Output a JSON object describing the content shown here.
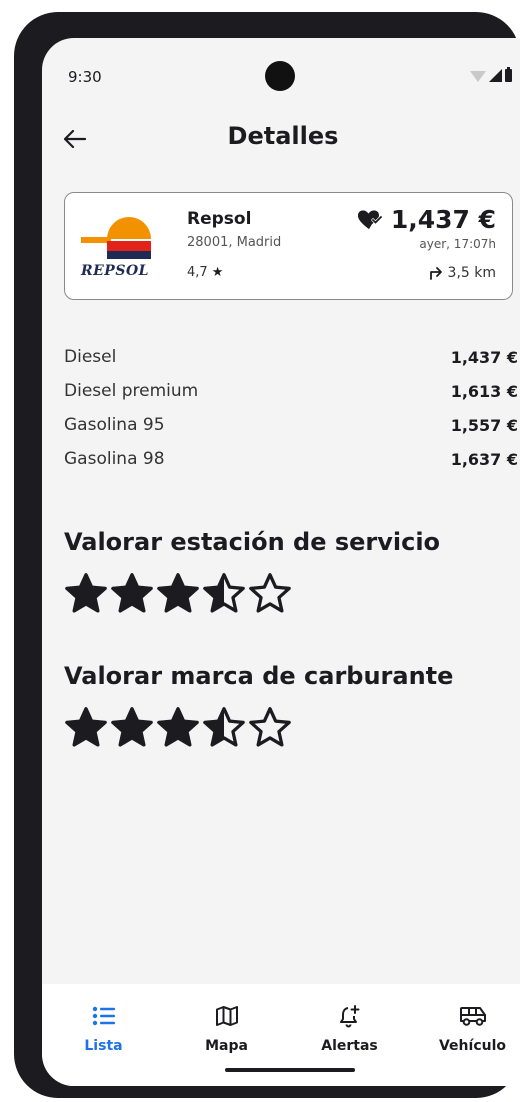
{
  "status_bar": {
    "time": "9:30"
  },
  "app_bar": {
    "title": "Detalles",
    "back_icon": "arrow-left-icon"
  },
  "station": {
    "brand_logo_text": "REPSOL",
    "name": "Repsol",
    "address": "28001, Madrid",
    "rating": "4,7",
    "price": "1,437 €",
    "updated": "ayer, 17:07h",
    "distance": "3,5 km"
  },
  "fuels": [
    {
      "name": "Diesel",
      "price": "1,437 €"
    },
    {
      "name": "Diesel premium",
      "price": "1,613 €"
    },
    {
      "name": "Gasolina 95",
      "price": "1,557 €"
    },
    {
      "name": "Gasolina 98",
      "price": "1,637 €"
    }
  ],
  "rate_station": {
    "title": "Valorar estación de servicio",
    "stars": 3.5,
    "max": 5
  },
  "rate_brand": {
    "title": "Valorar marca de carburante",
    "stars": 3.5,
    "max": 5
  },
  "bottom_nav": [
    {
      "label": "Lista",
      "icon": "list-icon",
      "active": true
    },
    {
      "label": "Mapa",
      "icon": "map-icon",
      "active": false
    },
    {
      "label": "Alertas",
      "icon": "bell-plus-icon",
      "active": false
    },
    {
      "label": "Vehículo",
      "icon": "van-icon",
      "active": false
    }
  ],
  "colors": {
    "accent": "#1e73e6",
    "background": "#f4f4f4",
    "text": "#1c1b1f",
    "repsol_orange": "#f39200",
    "repsol_red": "#e2231a",
    "repsol_navy": "#1f2a55"
  }
}
